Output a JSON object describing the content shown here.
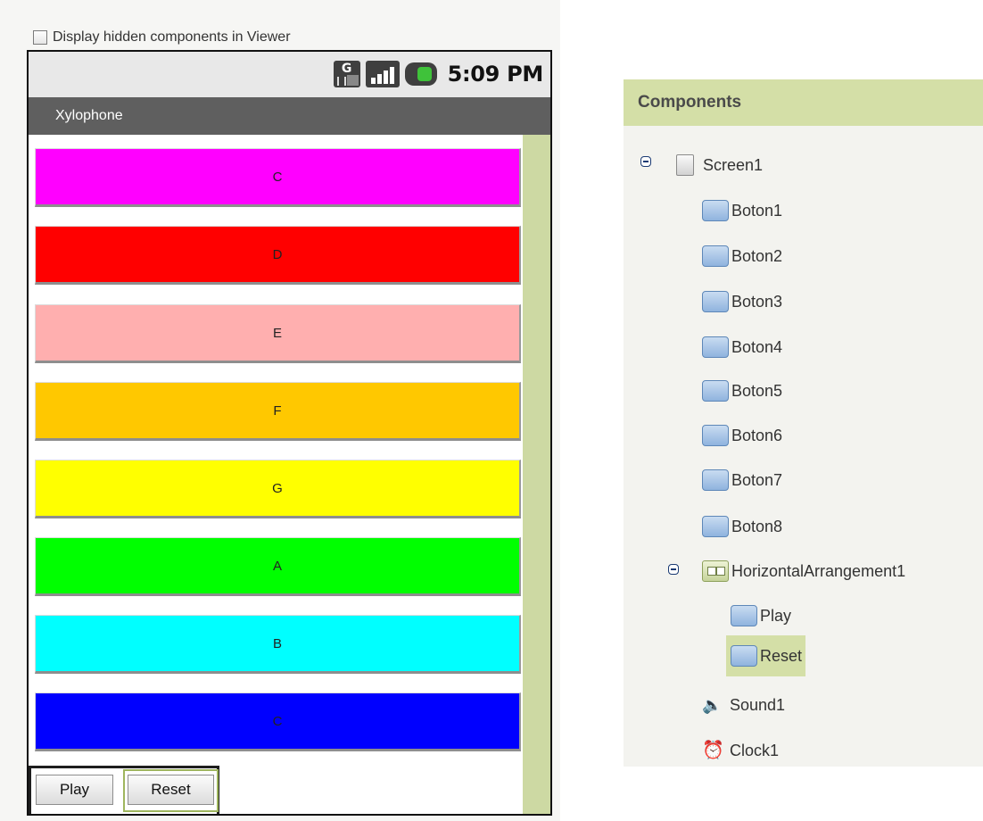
{
  "viewer": {
    "hidden_components_label": "Display hidden components in Viewer",
    "status_bar": {
      "time": "5:09 PM",
      "network_label": "G"
    },
    "app_title": "Xylophone",
    "note_buttons": [
      {
        "label": "C",
        "color": "#ff00ff"
      },
      {
        "label": "D",
        "color": "#ff0000"
      },
      {
        "label": "E",
        "color": "#ffafaf"
      },
      {
        "label": "F",
        "color": "#ffc800"
      },
      {
        "label": "G",
        "color": "#ffff00"
      },
      {
        "label": "A",
        "color": "#00ff00"
      },
      {
        "label": "B",
        "color": "#00ffff"
      },
      {
        "label": "C",
        "color": "#0000ff"
      }
    ],
    "arrangement_buttons": {
      "play": "Play",
      "reset": "Reset"
    }
  },
  "components": {
    "header": "Components",
    "tree": {
      "screen": "Screen1",
      "buttons": [
        "Boton1",
        "Boton2",
        "Boton3",
        "Boton4",
        "Boton5",
        "Boton6",
        "Boton7",
        "Boton8"
      ],
      "arrangement": "HorizontalArrangement1",
      "arrangement_children": [
        "Play",
        "Reset"
      ],
      "selected": "Reset",
      "sound": "Sound1",
      "clock": "Clock1"
    }
  },
  "colors": {
    "selection_green": "#d4dfa7",
    "scrollbar_green": "#cdd9a3",
    "title_bar": "#5f5f5f"
  },
  "icons": {
    "checkbox": "checkbox-icon",
    "collapse": "collapse-icon",
    "screen": "screen-icon",
    "button": "button-icon",
    "arrangement": "horizontal-arrangement-icon",
    "sound": "speaker-icon",
    "clock": "alarm-clock-icon"
  }
}
